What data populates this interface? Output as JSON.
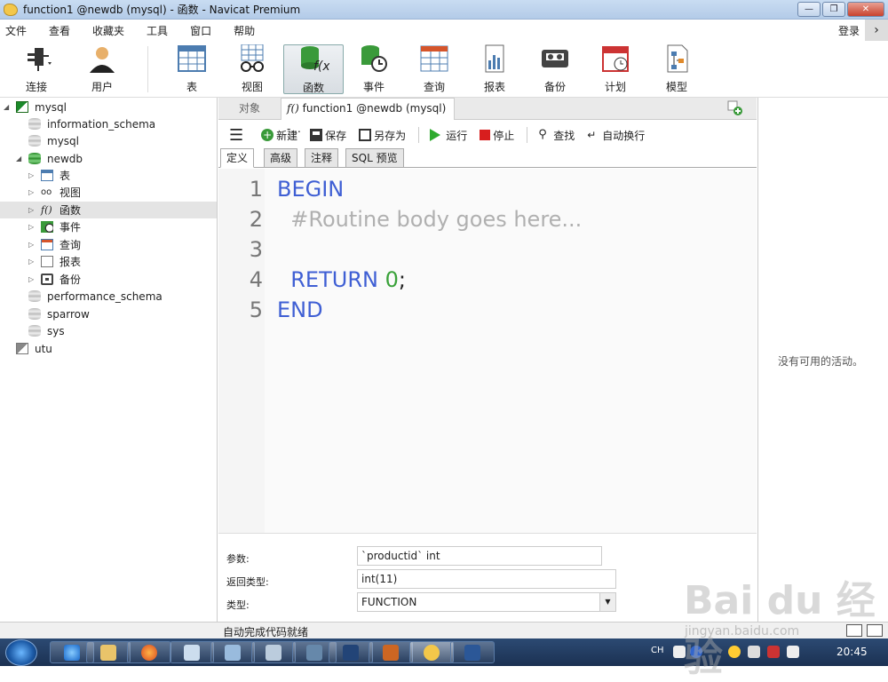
{
  "window": {
    "title": "function1 @newdb (mysql) - 函数 - Navicat Premium"
  },
  "menu": {
    "items": [
      "文件",
      "查看",
      "收藏夹",
      "工具",
      "窗口",
      "帮助"
    ],
    "login": "登录"
  },
  "toolbar": {
    "connect": "连接",
    "user": "用户",
    "table": "表",
    "view": "视图",
    "function": "函数",
    "event": "事件",
    "query": "查询",
    "report": "报表",
    "backup": "备份",
    "schedule": "计划",
    "model": "模型"
  },
  "tree": {
    "mysql": "mysql",
    "information_schema": "information_schema",
    "mysql_db": "mysql",
    "newdb": "newdb",
    "tables": "表",
    "views": "视图",
    "functions": "函数",
    "events": "事件",
    "queries": "查询",
    "reports": "报表",
    "backups": "备份",
    "performance_schema": "performance_schema",
    "sparrow": "sparrow",
    "sys": "sys",
    "utu": "utu"
  },
  "tabs": {
    "objects": "对象",
    "function_tab": "function1 @newdb (mysql) -..."
  },
  "editor_toolbar": {
    "new": "新建",
    "save": "保存",
    "save_as": "另存为",
    "run": "运行",
    "stop": "停止",
    "find": "查找",
    "word_wrap": "自动换行"
  },
  "subtabs": [
    "定义",
    "高级",
    "注释",
    "SQL 预览"
  ],
  "code": {
    "lines": [
      {
        "num": "1",
        "parts": [
          {
            "t": "BEGIN",
            "c": "kw"
          }
        ]
      },
      {
        "num": "2",
        "parts": [
          {
            "t": "  #Routine body goes here...",
            "c": "cm"
          }
        ]
      },
      {
        "num": "3",
        "parts": []
      },
      {
        "num": "4",
        "parts": [
          {
            "t": "  RETURN ",
            "c": "kw"
          },
          {
            "t": "0",
            "c": "num"
          },
          {
            "t": ";",
            "c": "plain"
          }
        ]
      },
      {
        "num": "5",
        "parts": [
          {
            "t": "END",
            "c": "kw"
          }
        ]
      }
    ]
  },
  "properties": {
    "params_label": "参数:",
    "params_value": "`productid` int",
    "return_label": "返回类型:",
    "return_value": "int(11)",
    "type_label": "类型:",
    "type_value": "FUNCTION"
  },
  "right_pane": {
    "message": "没有可用的活动。"
  },
  "status": {
    "text": "自动完成代码就绪"
  },
  "taskbar": {
    "lang": "CH",
    "clock": "20:45"
  },
  "watermark": {
    "logo": "Bai du 经验",
    "url": "jingyan.baidu.com"
  },
  "colors": {
    "keyword": "#3f5fd4",
    "comment": "#b0b0b0",
    "number": "#3aa23a"
  }
}
